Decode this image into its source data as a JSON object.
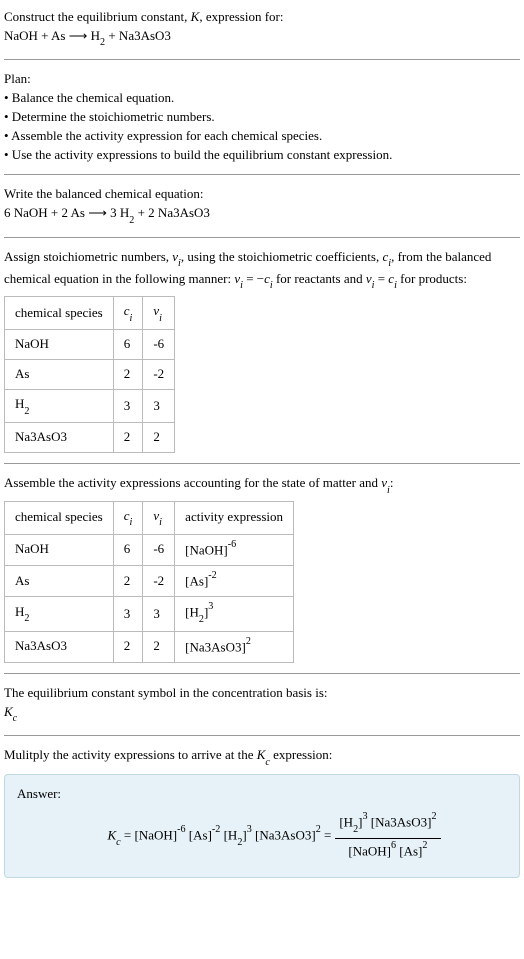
{
  "title_line1": "Construct the equilibrium constant, ",
  "title_K": "K",
  "title_line1_end": ", expression for:",
  "unbalanced_eq": "NaOH + As ⟶ H",
  "unbalanced_eq_2": " + Na3AsO3",
  "plan_header": "Plan:",
  "plan_items": [
    "• Balance the chemical equation.",
    "• Determine the stoichiometric numbers.",
    "• Assemble the activity expression for each chemical species.",
    "• Use the activity expressions to build the equilibrium constant expression."
  ],
  "balanced_header": "Write the balanced chemical equation:",
  "balanced_eq_a": "6 NaOH + 2 As ⟶ 3 H",
  "balanced_eq_b": " + 2 Na3AsO3",
  "stoich_text_a": "Assign stoichiometric numbers, ",
  "stoich_nu": "ν",
  "stoich_i": "i",
  "stoich_text_b": ", using the stoichiometric coefficients, ",
  "stoich_c": "c",
  "stoich_text_c": ", from the balanced chemical equation in the following manner: ",
  "stoich_text_d": " = −",
  "stoich_text_e": " for reactants and ",
  "stoich_text_f": " = ",
  "stoich_text_g": " for products:",
  "table1": {
    "headers": [
      "chemical species",
      "cᵢ",
      "νᵢ"
    ],
    "rows": [
      {
        "species": "NaOH",
        "c": "6",
        "v": "-6"
      },
      {
        "species": "As",
        "c": "2",
        "v": "-2"
      },
      {
        "species_a": "H",
        "species_sub": "2",
        "c": "3",
        "v": "3"
      },
      {
        "species": "Na3AsO3",
        "c": "2",
        "v": "2"
      }
    ]
  },
  "assemble_text_a": "Assemble the activity expressions accounting for the state of matter and ",
  "assemble_text_b": ":",
  "table2": {
    "headers": [
      "chemical species",
      "cᵢ",
      "νᵢ",
      "activity expression"
    ],
    "rows": [
      {
        "species": "NaOH",
        "c": "6",
        "v": "-6",
        "act_base": "[NaOH]",
        "act_exp": "-6"
      },
      {
        "species": "As",
        "c": "2",
        "v": "-2",
        "act_base": "[As]",
        "act_exp": "-2"
      },
      {
        "species_a": "H",
        "species_sub": "2",
        "c": "3",
        "v": "3",
        "act_base_a": "[H",
        "act_base_sub": "2",
        "act_base_b": "]",
        "act_exp": "3"
      },
      {
        "species": "Na3AsO3",
        "c": "2",
        "v": "2",
        "act_base": "[Na3AsO3]",
        "act_exp": "2"
      }
    ]
  },
  "eq_symbol_text": "The equilibrium constant symbol in the concentration basis is:",
  "Kc_a": "K",
  "Kc_b": "c",
  "multiply_text_a": "Mulitply the activity expressions to arrive at the ",
  "multiply_text_b": " expression:",
  "answer_label": "Answer:",
  "answer": {
    "Kc": "K",
    "Kc_sub": "c",
    "eq": " = [NaOH]",
    "exp1": "-6",
    "t2": " [As]",
    "exp2": "-2",
    "t3": " [H",
    "t3sub": "2",
    "t3b": "]",
    "exp3": "3",
    "t4": " [Na3AsO3]",
    "exp4": "2",
    "eqsign": " = ",
    "num_a": "[H",
    "num_sub": "2",
    "num_b": "]",
    "num_exp1": "3",
    "num_c": " [Na3AsO3]",
    "num_exp2": "2",
    "den_a": "[NaOH]",
    "den_exp1": "6",
    "den_b": " [As]",
    "den_exp2": "2"
  },
  "chart_data": {
    "type": "table",
    "tables": [
      {
        "title": "Stoichiometric numbers",
        "columns": [
          "chemical species",
          "c_i",
          "ν_i"
        ],
        "rows": [
          [
            "NaOH",
            6,
            -6
          ],
          [
            "As",
            2,
            -2
          ],
          [
            "H2",
            3,
            3
          ],
          [
            "Na3AsO3",
            2,
            2
          ]
        ]
      },
      {
        "title": "Activity expressions",
        "columns": [
          "chemical species",
          "c_i",
          "ν_i",
          "activity expression"
        ],
        "rows": [
          [
            "NaOH",
            6,
            -6,
            "[NaOH]^-6"
          ],
          [
            "As",
            2,
            -2,
            "[As]^-2"
          ],
          [
            "H2",
            3,
            3,
            "[H2]^3"
          ],
          [
            "Na3AsO3",
            2,
            2,
            "[Na3AsO3]^2"
          ]
        ]
      }
    ]
  }
}
